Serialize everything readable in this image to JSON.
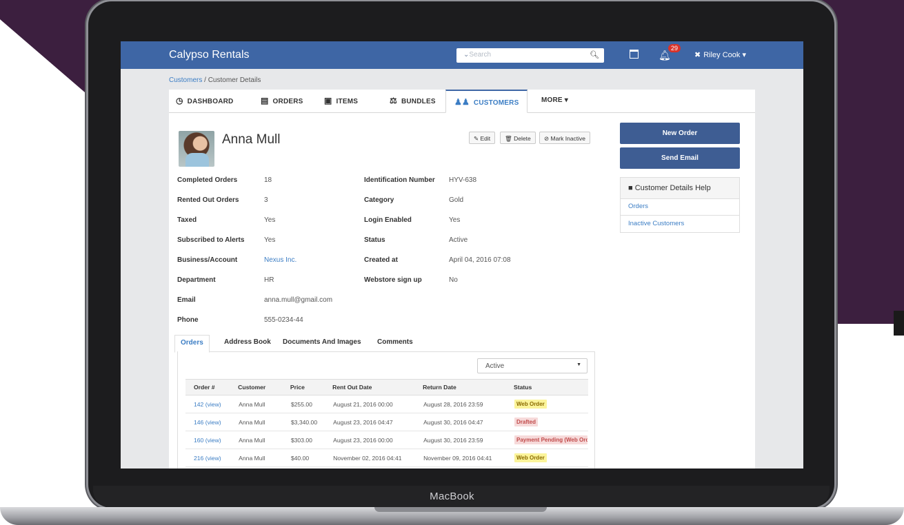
{
  "brand": "Calypso Rentals",
  "search": {
    "placeholder": "Search"
  },
  "notifications": {
    "count": "29"
  },
  "user": {
    "name": "Riley Cook",
    "menu_caret": "▾"
  },
  "breadcrumb": {
    "link": "Customers",
    "separator": " / ",
    "current": "Customer Details"
  },
  "tabs": [
    {
      "label": "DASHBOARD",
      "icon": "dashboard-icon"
    },
    {
      "label": "ORDERS",
      "icon": "clipboard-icon"
    },
    {
      "label": "ITEMS",
      "icon": "briefcase-icon"
    },
    {
      "label": "BUNDLES",
      "icon": "bundle-icon"
    },
    {
      "label": "CUSTOMERS",
      "icon": "users-icon",
      "active": true
    },
    {
      "label": "MORE ▾",
      "icon": ""
    }
  ],
  "customer": {
    "name": "Anna Mull",
    "actions": {
      "edit": "Edit",
      "delete": "Delete",
      "mark_inactive": "Mark Inactive"
    },
    "details_left": [
      {
        "label": "Completed Orders",
        "value": "18"
      },
      {
        "label": "Rented Out Orders",
        "value": "3"
      },
      {
        "label": "Taxed",
        "value": "Yes"
      },
      {
        "label": "Subscribed to Alerts",
        "value": "Yes"
      },
      {
        "label": "Business/Account",
        "value": "Nexus Inc."
      },
      {
        "label": "Department",
        "value": "HR"
      },
      {
        "label": "Email",
        "value": "anna.mull@gmail.com"
      },
      {
        "label": "Phone",
        "value": "555-0234-44"
      }
    ],
    "details_right": [
      {
        "label": "Identification Number",
        "value": "HYV-638"
      },
      {
        "label": "Category",
        "value": "Gold"
      },
      {
        "label": "Login Enabled",
        "value": "Yes"
      },
      {
        "label": "Status",
        "value": "Active"
      },
      {
        "label": "Created at",
        "value": "April 04, 2016 07:08"
      },
      {
        "label": "Webstore sign up",
        "value": "No"
      }
    ]
  },
  "subtabs": [
    "Orders",
    "Address Book",
    "Documents And Images",
    "Comments"
  ],
  "filter": {
    "selected": "Active"
  },
  "orders": {
    "columns": [
      "Order #",
      "Customer",
      "Price",
      "Rent Out Date",
      "Return Date",
      "Status"
    ],
    "rows": [
      {
        "order": "142 (view)",
        "customer": "Anna Mull",
        "price": "$255.00",
        "rent_out": "August 21, 2016 00:00",
        "return": "August 28, 2016 23:59",
        "status": "Web Order",
        "status_color": "#fbf49a"
      },
      {
        "order": "146 (view)",
        "customer": "Anna Mull",
        "price": "$3,340.00",
        "rent_out": "August 23, 2016 04:47",
        "return": "August 30, 2016 04:47",
        "status": "Drafted",
        "status_color": "#f6dada"
      },
      {
        "order": "160 (view)",
        "customer": "Anna Mull",
        "price": "$303.00",
        "rent_out": "August 23, 2016 00:00",
        "return": "August 30, 2016 23:59",
        "status": "Payment Pending (Web Order)",
        "status_color": "#f6dada"
      },
      {
        "order": "216 (view)",
        "customer": "Anna Mull",
        "price": "$40.00",
        "rent_out": "November 02, 2016 04:41",
        "return": "November 09, 2016 04:41",
        "status": "Web Order",
        "status_color": "#fbf49a"
      }
    ]
  },
  "sidebar": {
    "new_order": "New Order",
    "send_email": "Send Email",
    "help_title": "Customer Details Help",
    "help_links": [
      "Orders",
      "Inactive Customers"
    ]
  },
  "device_label": "MacBook",
  "colors": {
    "navbar": "#3e66a5",
    "accent": "#3b7dc4",
    "background": "#3c1f3f"
  }
}
